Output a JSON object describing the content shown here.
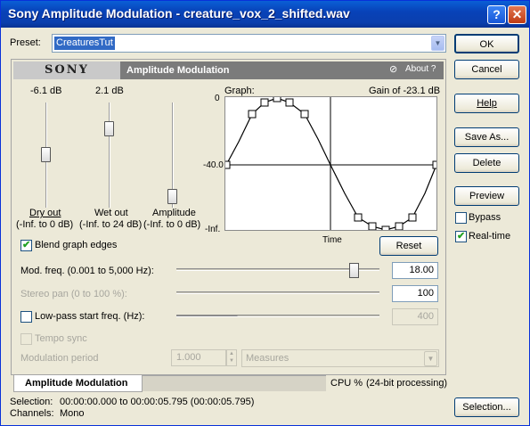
{
  "window": {
    "title": "Sony Amplitude Modulation - creature_vox_2_shifted.wav",
    "help_glyph": "?",
    "close_glyph": "✕"
  },
  "preset": {
    "label": "Preset:",
    "value": "CreaturesTut"
  },
  "buttons": {
    "ok": "OK",
    "cancel": "Cancel",
    "help": "Help",
    "save_as": "Save As...",
    "delete": "Delete",
    "preview": "Preview",
    "reset": "Reset",
    "selection": "Selection..."
  },
  "checks": {
    "bypass": "Bypass",
    "bypass_checked": false,
    "realtime": "Real-time",
    "realtime_checked": true
  },
  "plugin": {
    "brand": "SONY",
    "name": "Amplitude Modulation",
    "about": "About",
    "about_q": "?"
  },
  "sliders": {
    "dry": {
      "value": "-6.1 dB",
      "label": "Dry out",
      "range": "(-Inf. to 0 dB)",
      "level": 0.45
    },
    "wet": {
      "value": "2.1 dB",
      "label": "Wet out",
      "range": "(-Inf. to 24 dB)",
      "level": 0.72
    },
    "amp": {
      "label": "Amplitude",
      "range": "(-Inf. to 0 dB)",
      "level": 0.0
    }
  },
  "graph": {
    "label": "Graph:",
    "gain": "Gain of -23.1 dB",
    "y_top": "0",
    "y_mid": "-40.0",
    "y_bot": "-Inf.",
    "x_label": "Time"
  },
  "blend": {
    "label": "Blend graph edges",
    "checked": true
  },
  "params": {
    "mod_freq": {
      "label": "Mod. freq. (0.001 to 5,000 Hz):",
      "value": "18.00",
      "level": 0.97
    },
    "stereo_pan": {
      "label": "Stereo pan  (0 to 100 %):",
      "value": "100"
    },
    "lowpass": {
      "label": "Low-pass start freq. (Hz):",
      "value": "400"
    },
    "tempo_sync": {
      "label": "Tempo sync"
    },
    "mod_period": {
      "label": "Modulation period",
      "value": "1.000",
      "unit": "Measures"
    }
  },
  "tab": {
    "label": "Amplitude Modulation"
  },
  "cpu": {
    "label": "CPU %",
    "processing": "(24-bit processing)"
  },
  "status": {
    "selection_label": "Selection:",
    "selection": "00:00:00.000 to 00:00:05.795 (00:00:05.795)",
    "channels_label": "Channels:",
    "channels": "Mono"
  },
  "colors": {
    "titlebar": "#0a3fae",
    "selection": "#316ac5",
    "header": "#7b7b7b"
  }
}
